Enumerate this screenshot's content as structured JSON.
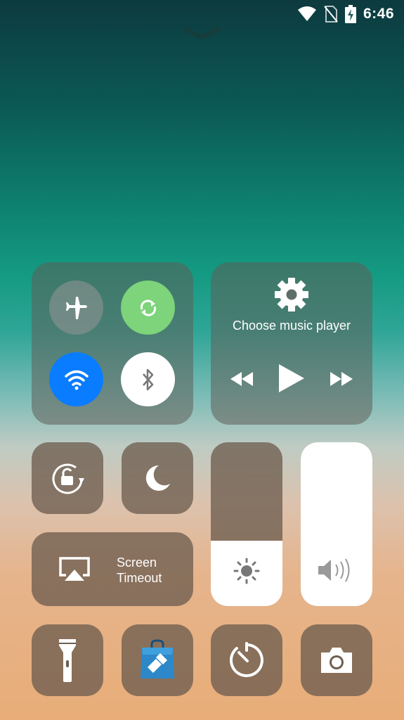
{
  "status_bar": {
    "time": "6:46",
    "icons": [
      "wifi-icon",
      "no-sim-icon",
      "battery-charging-icon"
    ]
  },
  "connectivity": {
    "airplane_mode": {
      "icon": "airplane-icon",
      "active": false
    },
    "sync": {
      "icon": "sync-icon",
      "active": true,
      "color": "#7dd47b"
    },
    "wifi": {
      "icon": "wifi-icon",
      "active": true,
      "color": "#0a7cff"
    },
    "bluetooth": {
      "icon": "bluetooth-icon",
      "active": true,
      "color": "#ffffff"
    }
  },
  "music": {
    "label": "Choose music player",
    "icons": [
      "gear-icon",
      "rewind-icon",
      "play-icon",
      "fast-forward-icon"
    ]
  },
  "toggles": {
    "rotation_lock": {
      "icon": "rotation-lock-icon"
    },
    "do_not_disturb": {
      "icon": "moon-icon"
    }
  },
  "screen_timeout": {
    "icon": "airplay-icon",
    "label_line1": "Screen",
    "label_line2": "Timeout"
  },
  "sliders": {
    "brightness": {
      "icon": "sun-icon",
      "level": 0.4
    },
    "volume": {
      "icon": "speaker-icon",
      "level": 1.0
    }
  },
  "shortcuts": [
    "flashlight-icon",
    "store-bag-icon",
    "timer-icon",
    "camera-icon"
  ]
}
